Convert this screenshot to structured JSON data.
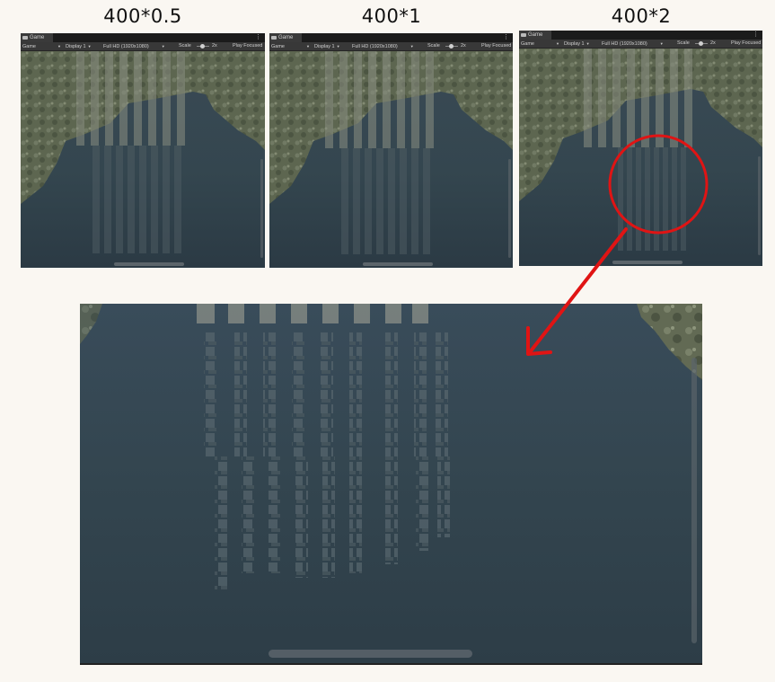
{
  "captions": [
    "400*0.5",
    "400*1",
    "400*2"
  ],
  "game_view": {
    "tab_label": "Game",
    "toolbar": {
      "mode": "Game",
      "display": "Display 1",
      "resolution": "Full HD (1920x1080)",
      "scale_label": "Scale",
      "scale_value": "2x",
      "play_mode": "Play Focused"
    }
  },
  "annotation": {
    "circle_color": "#e01414",
    "arrow_color": "#e01414"
  },
  "colors": {
    "water": "#34464f",
    "background": "#faf7f2"
  }
}
